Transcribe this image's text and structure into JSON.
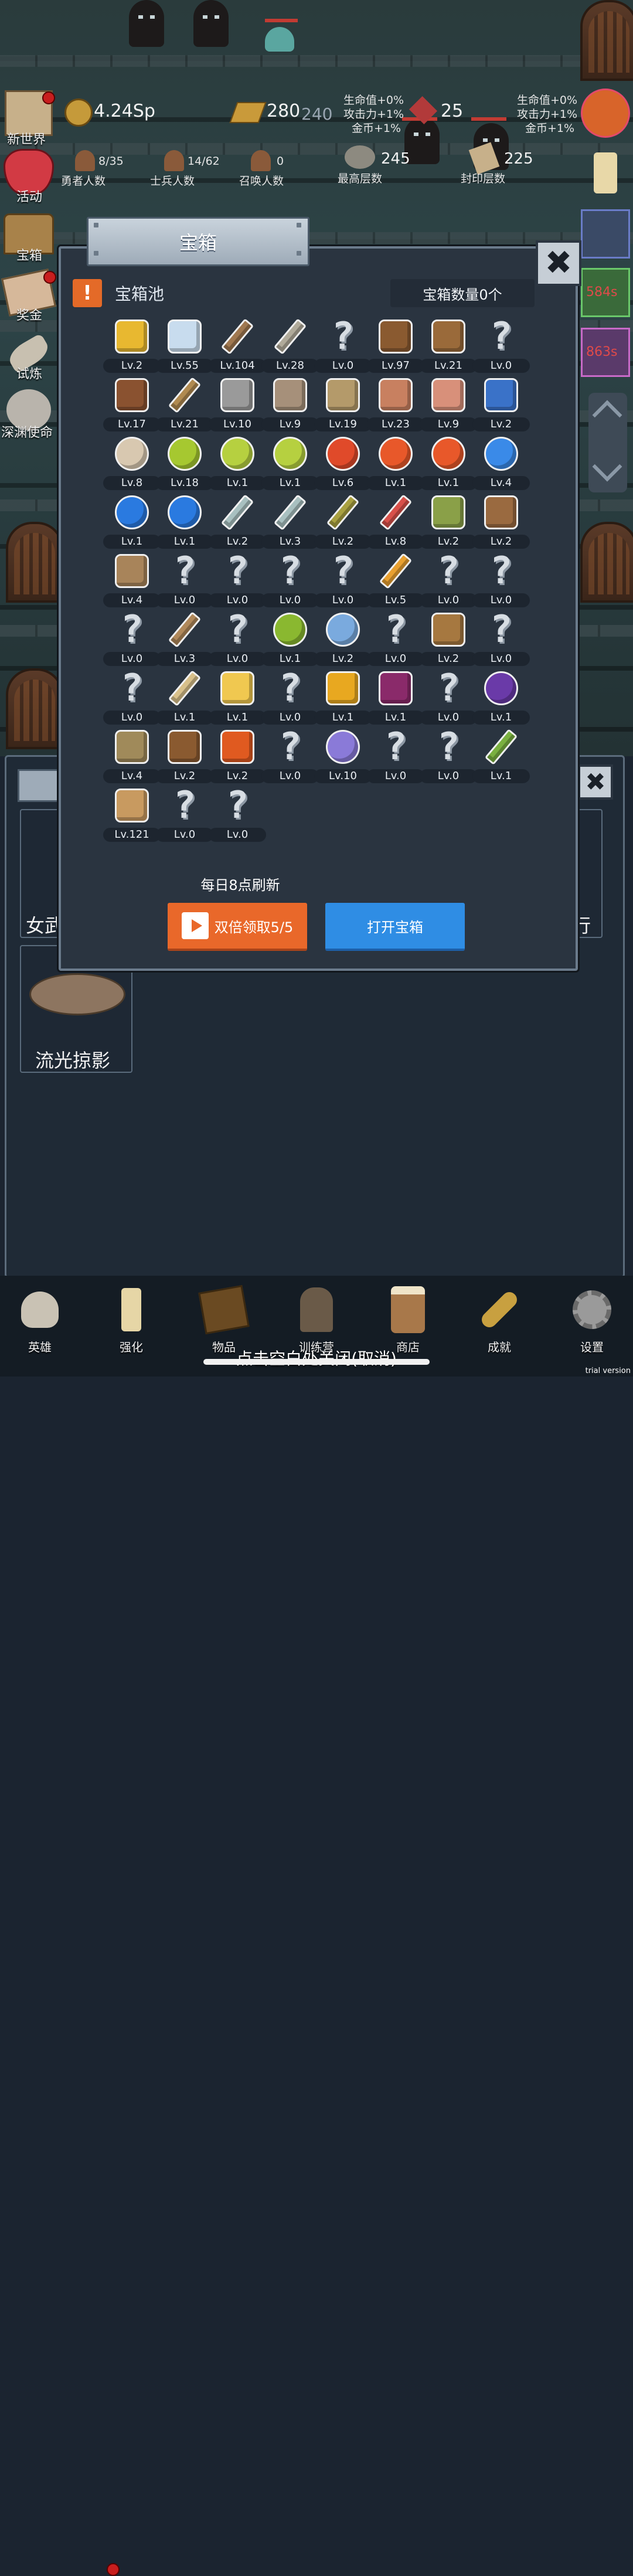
{
  "hud": {
    "coins": "4.24Sp",
    "gold_bars": "280",
    "gold_bars_cap": "240",
    "gems": "25",
    "bonus_left": [
      "生命值+0%",
      "攻击力+1%",
      "金币+1%"
    ],
    "bonus_right": [
      "生命值+0%",
      "攻击力+1%",
      "金币+1%"
    ],
    "stats": [
      {
        "value": "8/35",
        "label": "勇者人数"
      },
      {
        "value": "14/62",
        "label": "士兵人数"
      },
      {
        "value": "0",
        "label": "召唤人数"
      },
      {
        "value": "245",
        "label": "最高层数"
      },
      {
        "value": "225",
        "label": "封印层数"
      }
    ]
  },
  "left_menu": [
    "新世界",
    "活动",
    "宝箱",
    "奖金",
    "试炼",
    "深渊使命"
  ],
  "right_timers": [
    "584s",
    "863s"
  ],
  "modal": {
    "title": "宝箱",
    "pool_title": "宝箱池",
    "warn_mark": "!",
    "chest_count": "宝箱数量0个",
    "refresh_note": "每日8点刷新",
    "double_button": "双倍领取5/5",
    "open_button": "打开宝箱",
    "close_glyph": "✖"
  },
  "items": [
    {
      "icon": "crown",
      "lv": "Lv.2"
    },
    {
      "icon": "diamond",
      "lv": "Lv.55"
    },
    {
      "icon": "bronze-sword",
      "lv": "Lv.104"
    },
    {
      "icon": "iron-sword",
      "lv": "Lv.28"
    },
    {
      "icon": "unknown",
      "lv": "Lv.0"
    },
    {
      "icon": "leather-armor",
      "lv": "Lv.97"
    },
    {
      "icon": "backpack",
      "lv": "Lv.21"
    },
    {
      "icon": "unknown",
      "lv": "Lv.0"
    },
    {
      "icon": "leather-helmet",
      "lv": "Lv.17"
    },
    {
      "icon": "dagger",
      "lv": "Lv.21"
    },
    {
      "icon": "knight-helmet",
      "lv": "Lv.10"
    },
    {
      "icon": "hammer",
      "lv": "Lv.9"
    },
    {
      "icon": "great-helm",
      "lv": "Lv.19"
    },
    {
      "icon": "ham",
      "lv": "Lv.23"
    },
    {
      "icon": "steak",
      "lv": "Lv.9"
    },
    {
      "icon": "blue-sack",
      "lv": "Lv.2"
    },
    {
      "icon": "flour-bowl",
      "lv": "Lv.8"
    },
    {
      "icon": "green-potion",
      "lv": "Lv.18"
    },
    {
      "icon": "green-flask",
      "lv": "Lv.1"
    },
    {
      "icon": "green-flask",
      "lv": "Lv.1"
    },
    {
      "icon": "red-potion",
      "lv": "Lv.6"
    },
    {
      "icon": "red-flask",
      "lv": "Lv.1"
    },
    {
      "icon": "red-flask",
      "lv": "Lv.1"
    },
    {
      "icon": "blue-potion",
      "lv": "Lv.4"
    },
    {
      "icon": "blue-flask",
      "lv": "Lv.1"
    },
    {
      "icon": "blue-flask",
      "lv": "Lv.1"
    },
    {
      "icon": "vial",
      "lv": "Lv.2"
    },
    {
      "icon": "vial",
      "lv": "Lv.3"
    },
    {
      "icon": "olive-bottle",
      "lv": "Lv.2"
    },
    {
      "icon": "red-vial",
      "lv": "Lv.8"
    },
    {
      "icon": "winged-boot",
      "lv": "Lv.2"
    },
    {
      "icon": "boot",
      "lv": "Lv.2"
    },
    {
      "icon": "shoe",
      "lv": "Lv.4"
    },
    {
      "icon": "unknown",
      "lv": "Lv.0"
    },
    {
      "icon": "unknown",
      "lv": "Lv.0"
    },
    {
      "icon": "unknown",
      "lv": "Lv.0"
    },
    {
      "icon": "unknown",
      "lv": "Lv.0"
    },
    {
      "icon": "torch-staff",
      "lv": "Lv.5"
    },
    {
      "icon": "unknown",
      "lv": "Lv.0"
    },
    {
      "icon": "unknown",
      "lv": "Lv.0"
    },
    {
      "icon": "unknown",
      "lv": "Lv.0"
    },
    {
      "icon": "crook-staff",
      "lv": "Lv.3"
    },
    {
      "icon": "unknown",
      "lv": "Lv.0"
    },
    {
      "icon": "lime-fruit",
      "lv": "Lv.1"
    },
    {
      "icon": "orb-wand",
      "lv": "Lv.2"
    },
    {
      "icon": "unknown",
      "lv": "Lv.0"
    },
    {
      "icon": "big-backpack",
      "lv": "Lv.2"
    },
    {
      "icon": "unknown",
      "lv": "Lv.0"
    },
    {
      "icon": "unknown",
      "lv": "Lv.0"
    },
    {
      "icon": "bone-club",
      "lv": "Lv.1"
    },
    {
      "icon": "cheese",
      "lv": "Lv.1"
    },
    {
      "icon": "unknown",
      "lv": "Lv.0"
    },
    {
      "icon": "honey-jar",
      "lv": "Lv.1"
    },
    {
      "icon": "dark-crystal",
      "lv": "Lv.1"
    },
    {
      "icon": "unknown",
      "lv": "Lv.0"
    },
    {
      "icon": "magic-cube",
      "lv": "Lv.1"
    },
    {
      "icon": "bow",
      "lv": "Lv.4"
    },
    {
      "icon": "quiver",
      "lv": "Lv.2"
    },
    {
      "icon": "fire-shield",
      "lv": "Lv.2"
    },
    {
      "icon": "unknown",
      "lv": "Lv.0"
    },
    {
      "icon": "tentacle-orb",
      "lv": "Lv.10"
    },
    {
      "icon": "unknown",
      "lv": "Lv.0"
    },
    {
      "icon": "unknown",
      "lv": "Lv.0"
    },
    {
      "icon": "green-wand",
      "lv": "Lv.1"
    },
    {
      "icon": "beer-mug",
      "lv": "Lv.121"
    },
    {
      "icon": "unknown",
      "lv": "Lv.0"
    },
    {
      "icon": "unknown",
      "lv": "Lv.0"
    }
  ],
  "underlying": {
    "card_left_label": "女武",
    "card_right_label": "行",
    "card_bottom_label": "流光掠影"
  },
  "nav": [
    "英雄",
    "强化",
    "物品",
    "训练营",
    "商店",
    "成就",
    "设置"
  ],
  "close_hint": "点击空白处关闭(取消)",
  "watermark": "trial version"
}
